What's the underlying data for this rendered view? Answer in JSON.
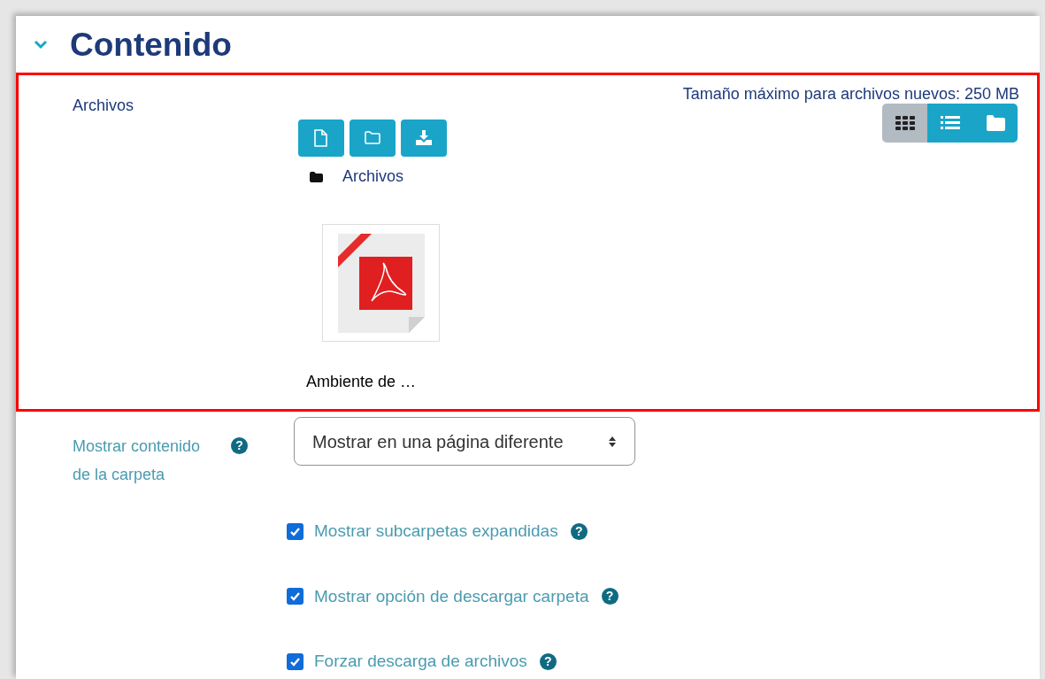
{
  "section": {
    "title": "Contenido",
    "expanded": true
  },
  "file_picker": {
    "label": "Archivos",
    "max_size": "Tamaño máximo para archivos nuevos: 250 MB",
    "actions": [
      {
        "kind": "file"
      },
      {
        "kind": "folder"
      },
      {
        "kind": "download"
      }
    ],
    "view_modes": [
      {
        "kind": "grid",
        "selected": true
      },
      {
        "kind": "list",
        "selected": false
      },
      {
        "kind": "tree",
        "selected": false
      }
    ],
    "path": "Archivos",
    "files": [
      {
        "name": "Ambiente de …",
        "kind": "pdf"
      }
    ]
  },
  "display": {
    "label": "Mostrar contenido de la carpeta",
    "help": "?",
    "value": "Mostrar en una página diferente"
  },
  "options": [
    {
      "label": "Mostrar subcarpetas expandidas",
      "help": "?",
      "checked": true
    },
    {
      "label": "Mostrar opción de descargar carpeta",
      "help": "?",
      "checked": true
    },
    {
      "label": "Forzar descarga de archivos",
      "help": "?",
      "checked": true
    }
  ]
}
